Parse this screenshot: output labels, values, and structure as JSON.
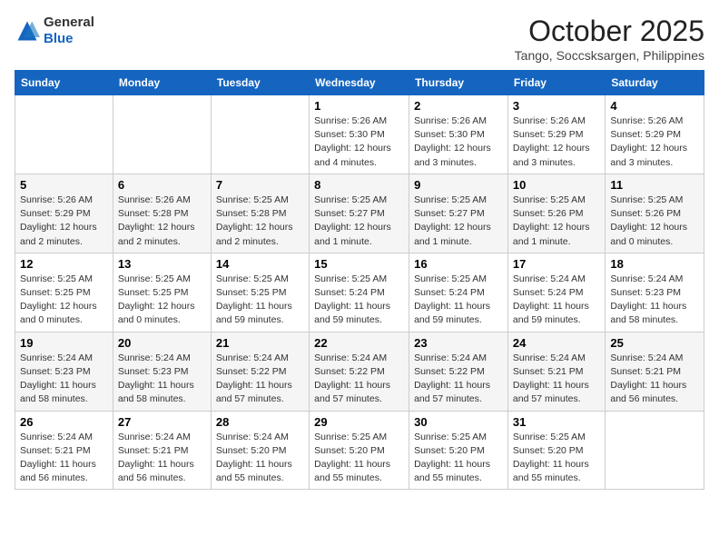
{
  "header": {
    "logo_line1": "General",
    "logo_line2": "Blue",
    "title": "October 2025",
    "subtitle": "Tango, Soccsksargen, Philippines"
  },
  "weekdays": [
    "Sunday",
    "Monday",
    "Tuesday",
    "Wednesday",
    "Thursday",
    "Friday",
    "Saturday"
  ],
  "weeks": [
    [
      {
        "day": "",
        "info": ""
      },
      {
        "day": "",
        "info": ""
      },
      {
        "day": "",
        "info": ""
      },
      {
        "day": "1",
        "info": "Sunrise: 5:26 AM\nSunset: 5:30 PM\nDaylight: 12 hours and 4 minutes."
      },
      {
        "day": "2",
        "info": "Sunrise: 5:26 AM\nSunset: 5:30 PM\nDaylight: 12 hours and 3 minutes."
      },
      {
        "day": "3",
        "info": "Sunrise: 5:26 AM\nSunset: 5:29 PM\nDaylight: 12 hours and 3 minutes."
      },
      {
        "day": "4",
        "info": "Sunrise: 5:26 AM\nSunset: 5:29 PM\nDaylight: 12 hours and 3 minutes."
      }
    ],
    [
      {
        "day": "5",
        "info": "Sunrise: 5:26 AM\nSunset: 5:29 PM\nDaylight: 12 hours and 2 minutes."
      },
      {
        "day": "6",
        "info": "Sunrise: 5:26 AM\nSunset: 5:28 PM\nDaylight: 12 hours and 2 minutes."
      },
      {
        "day": "7",
        "info": "Sunrise: 5:25 AM\nSunset: 5:28 PM\nDaylight: 12 hours and 2 minutes."
      },
      {
        "day": "8",
        "info": "Sunrise: 5:25 AM\nSunset: 5:27 PM\nDaylight: 12 hours and 1 minute."
      },
      {
        "day": "9",
        "info": "Sunrise: 5:25 AM\nSunset: 5:27 PM\nDaylight: 12 hours and 1 minute."
      },
      {
        "day": "10",
        "info": "Sunrise: 5:25 AM\nSunset: 5:26 PM\nDaylight: 12 hours and 1 minute."
      },
      {
        "day": "11",
        "info": "Sunrise: 5:25 AM\nSunset: 5:26 PM\nDaylight: 12 hours and 0 minutes."
      }
    ],
    [
      {
        "day": "12",
        "info": "Sunrise: 5:25 AM\nSunset: 5:25 PM\nDaylight: 12 hours and 0 minutes."
      },
      {
        "day": "13",
        "info": "Sunrise: 5:25 AM\nSunset: 5:25 PM\nDaylight: 12 hours and 0 minutes."
      },
      {
        "day": "14",
        "info": "Sunrise: 5:25 AM\nSunset: 5:25 PM\nDaylight: 11 hours and 59 minutes."
      },
      {
        "day": "15",
        "info": "Sunrise: 5:25 AM\nSunset: 5:24 PM\nDaylight: 11 hours and 59 minutes."
      },
      {
        "day": "16",
        "info": "Sunrise: 5:25 AM\nSunset: 5:24 PM\nDaylight: 11 hours and 59 minutes."
      },
      {
        "day": "17",
        "info": "Sunrise: 5:24 AM\nSunset: 5:24 PM\nDaylight: 11 hours and 59 minutes."
      },
      {
        "day": "18",
        "info": "Sunrise: 5:24 AM\nSunset: 5:23 PM\nDaylight: 11 hours and 58 minutes."
      }
    ],
    [
      {
        "day": "19",
        "info": "Sunrise: 5:24 AM\nSunset: 5:23 PM\nDaylight: 11 hours and 58 minutes."
      },
      {
        "day": "20",
        "info": "Sunrise: 5:24 AM\nSunset: 5:23 PM\nDaylight: 11 hours and 58 minutes."
      },
      {
        "day": "21",
        "info": "Sunrise: 5:24 AM\nSunset: 5:22 PM\nDaylight: 11 hours and 57 minutes."
      },
      {
        "day": "22",
        "info": "Sunrise: 5:24 AM\nSunset: 5:22 PM\nDaylight: 11 hours and 57 minutes."
      },
      {
        "day": "23",
        "info": "Sunrise: 5:24 AM\nSunset: 5:22 PM\nDaylight: 11 hours and 57 minutes."
      },
      {
        "day": "24",
        "info": "Sunrise: 5:24 AM\nSunset: 5:21 PM\nDaylight: 11 hours and 57 minutes."
      },
      {
        "day": "25",
        "info": "Sunrise: 5:24 AM\nSunset: 5:21 PM\nDaylight: 11 hours and 56 minutes."
      }
    ],
    [
      {
        "day": "26",
        "info": "Sunrise: 5:24 AM\nSunset: 5:21 PM\nDaylight: 11 hours and 56 minutes."
      },
      {
        "day": "27",
        "info": "Sunrise: 5:24 AM\nSunset: 5:21 PM\nDaylight: 11 hours and 56 minutes."
      },
      {
        "day": "28",
        "info": "Sunrise: 5:24 AM\nSunset: 5:20 PM\nDaylight: 11 hours and 55 minutes."
      },
      {
        "day": "29",
        "info": "Sunrise: 5:25 AM\nSunset: 5:20 PM\nDaylight: 11 hours and 55 minutes."
      },
      {
        "day": "30",
        "info": "Sunrise: 5:25 AM\nSunset: 5:20 PM\nDaylight: 11 hours and 55 minutes."
      },
      {
        "day": "31",
        "info": "Sunrise: 5:25 AM\nSunset: 5:20 PM\nDaylight: 11 hours and 55 minutes."
      },
      {
        "day": "",
        "info": ""
      }
    ]
  ]
}
